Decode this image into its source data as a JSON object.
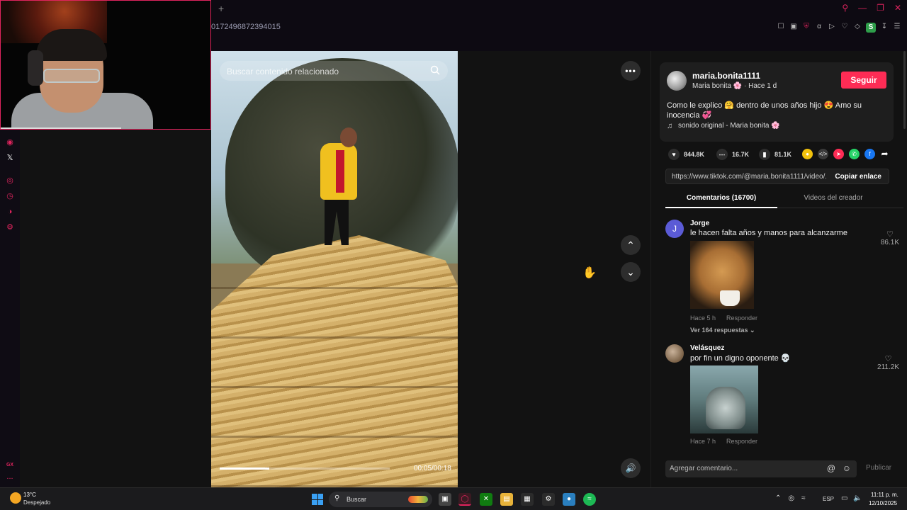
{
  "browser": {
    "new_tab_icon": "+",
    "url_fragment": "0172496872394015",
    "window_controls": [
      "search-icon",
      "minimize-icon",
      "restore-icon",
      "close-icon"
    ],
    "extensions": [
      "bookmark-icon",
      "screenshot-icon",
      "shield-icon",
      "translate-icon",
      "play-icon",
      "heart-icon",
      "extensions-icon",
      "profile-icon",
      "download-icon",
      "menu-icon"
    ],
    "profile_letter": "S"
  },
  "sidebar": {
    "items": [
      "instagram-icon",
      "x-icon",
      "player-icon",
      "history-icon",
      "messenger-icon",
      "settings-icon"
    ],
    "bottom_label": "GX",
    "bottom_more": "..."
  },
  "video": {
    "search_placeholder": "Buscar contenido relacionado",
    "time": "00:05/00:18",
    "progress": 0.29
  },
  "author": {
    "username": "maria.bonita1111",
    "display": "Maria bonita 🌸 · Hace 1 d",
    "follow": "Seguir",
    "caption": "Como le explico 🤗 dentro de unos años hijo 😍 Amo su inocencia 💞",
    "sound": "sonido original - Maria bonita 🌸"
  },
  "stats": {
    "likes": "844.8K",
    "comments": "16.7K",
    "saves": "81.1K"
  },
  "share": {
    "colors": [
      "#f2c20c",
      "#3a3a3a",
      "#fe2c55",
      "#25d366",
      "#1877f2"
    ]
  },
  "link": {
    "url": "https://www.tiktok.com/@maria.bonita1111/video/...",
    "copy": "Copiar enlace"
  },
  "tabs": {
    "comments": "Comentarios (16700)",
    "creator": "Videos del creador"
  },
  "comments": [
    {
      "initial": "J",
      "user": "Jorge",
      "text": "le hacen falta años y manos para alcanzarme",
      "likes": "86.1K",
      "time": "Hace 5 h",
      "reply": "Responder",
      "more": "Ver 164 respuestas ⌄"
    },
    {
      "initial": "",
      "user": "Velásquez",
      "text": "por fin un digno oponente 💀",
      "likes": "211.2K",
      "time": "Hace 7 h",
      "reply": "Responder"
    }
  ],
  "composer": {
    "placeholder": "Agregar comentario...",
    "publish": "Publicar"
  },
  "taskbar": {
    "temp": "13°C",
    "condition": "Despejado",
    "search": "Buscar",
    "language": "ESP",
    "time": "11:11 p. m.",
    "date": "12/10/2025"
  }
}
